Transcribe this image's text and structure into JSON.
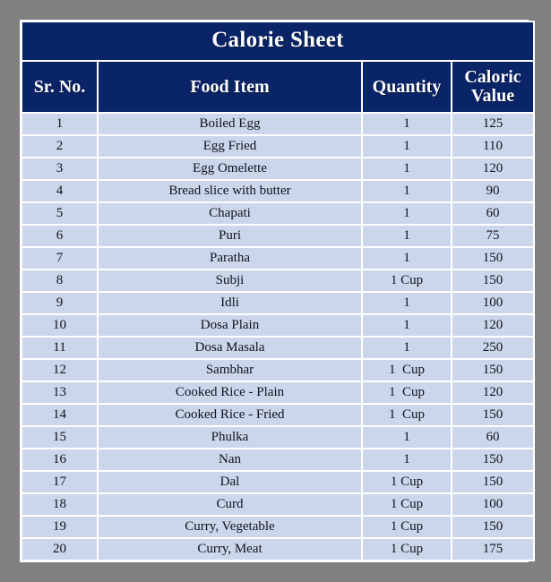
{
  "page": {
    "background_color": "#808080"
  },
  "table": {
    "title": "Calorie Sheet",
    "header_bg": "#0a2468",
    "header_text_color": "#ffffff",
    "row_bg": "#ccd6ea",
    "row_text_color": "#0d1320",
    "columns": [
      {
        "key": "sr",
        "label": "Sr. No."
      },
      {
        "key": "food",
        "label": "Food Item"
      },
      {
        "key": "qty",
        "label": "Quantity"
      },
      {
        "key": "cal",
        "label": "Caloric Value"
      }
    ],
    "rows": [
      {
        "sr": "1",
        "food": "Boiled Egg",
        "qty": "1",
        "cal": "125"
      },
      {
        "sr": "2",
        "food": "Egg Fried",
        "qty": "1",
        "cal": "110"
      },
      {
        "sr": "3",
        "food": "Egg Omelette",
        "qty": "1",
        "cal": "120"
      },
      {
        "sr": "4",
        "food": "Bread slice with butter",
        "qty": "1",
        "cal": "90"
      },
      {
        "sr": "5",
        "food": "Chapati",
        "qty": "1",
        "cal": "60"
      },
      {
        "sr": "6",
        "food": "Puri",
        "qty": "1",
        "cal": "75"
      },
      {
        "sr": "7",
        "food": "Paratha",
        "qty": "1",
        "cal": "150"
      },
      {
        "sr": "8",
        "food": "Subji",
        "qty": "1 Cup",
        "cal": "150"
      },
      {
        "sr": "9",
        "food": "Idli",
        "qty": "1",
        "cal": "100"
      },
      {
        "sr": "10",
        "food": "Dosa Plain",
        "qty": "1",
        "cal": "120"
      },
      {
        "sr": "11",
        "food": "Dosa Masala",
        "qty": "1",
        "cal": "250"
      },
      {
        "sr": "12",
        "food": "Sambhar",
        "qty": "1  Cup",
        "cal": "150"
      },
      {
        "sr": "13",
        "food": "Cooked Rice - Plain",
        "qty": "1  Cup",
        "cal": "120"
      },
      {
        "sr": "14",
        "food": "Cooked Rice - Fried",
        "qty": "1  Cup",
        "cal": "150"
      },
      {
        "sr": "15",
        "food": "Phulka",
        "qty": "1",
        "cal": "60"
      },
      {
        "sr": "16",
        "food": "Nan",
        "qty": "1",
        "cal": "150"
      },
      {
        "sr": "17",
        "food": "Dal",
        "qty": "1 Cup",
        "cal": "150"
      },
      {
        "sr": "18",
        "food": "Curd",
        "qty": "1 Cup",
        "cal": "100"
      },
      {
        "sr": "19",
        "food": "Curry, Vegetable",
        "qty": "1 Cup",
        "cal": "150"
      },
      {
        "sr": "20",
        "food": "Curry, Meat",
        "qty": "1 Cup",
        "cal": "175"
      }
    ]
  }
}
